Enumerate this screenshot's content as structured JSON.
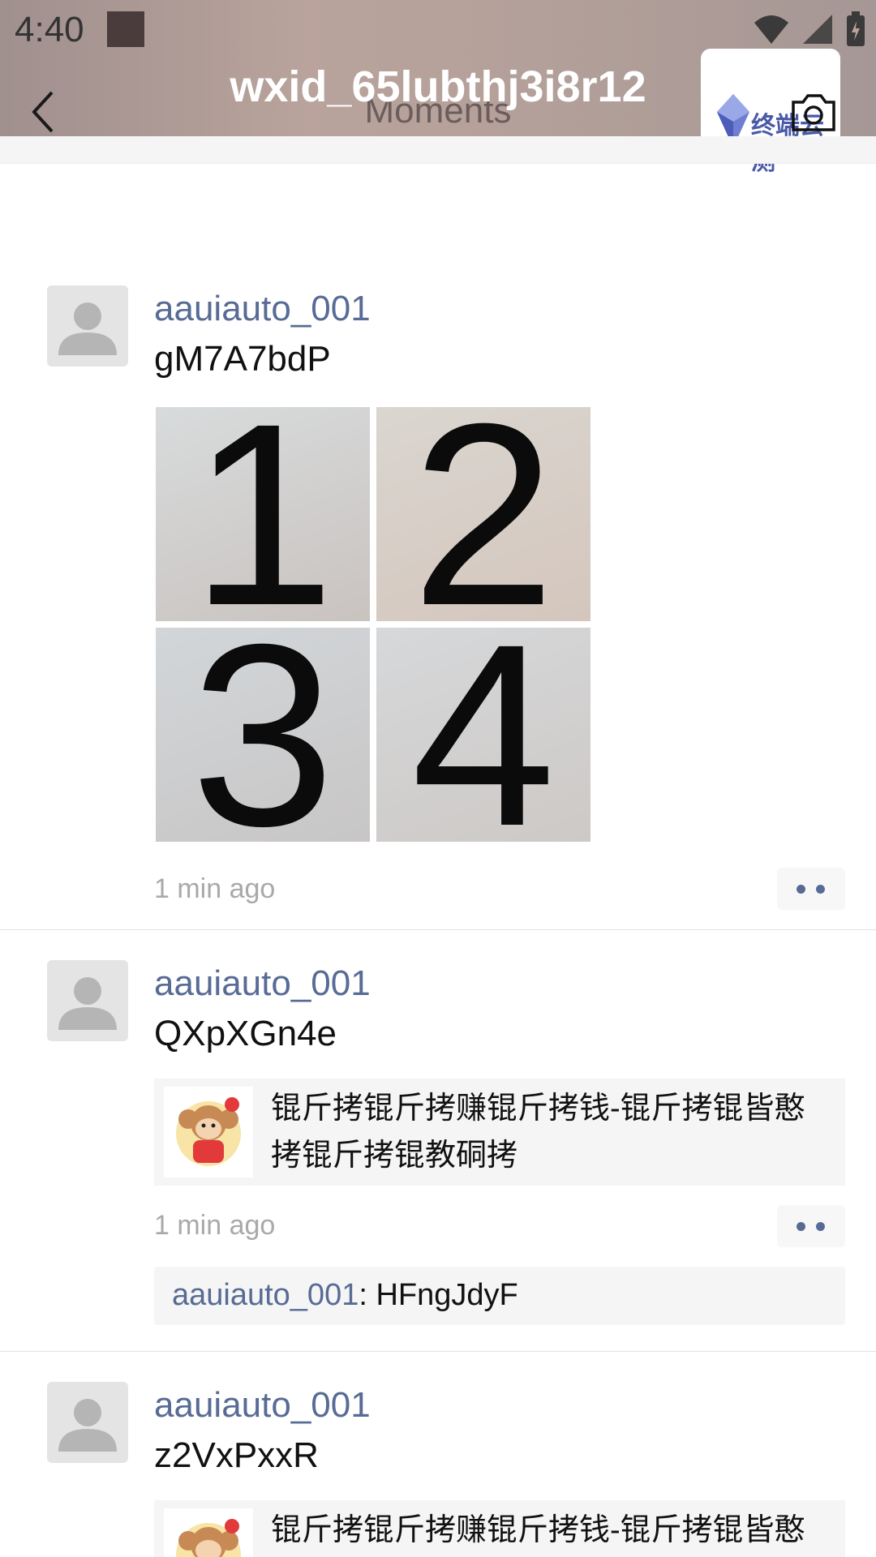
{
  "status_bar": {
    "time": "4:40"
  },
  "header": {
    "title": "wxid_65lubthj3i8r12",
    "subtitle": "Moments",
    "logo_text": "终端云测"
  },
  "posts": [
    {
      "author": "aauiauto_001",
      "text": "gM7A7bdP",
      "photos": [
        "1",
        "2",
        "3",
        "4"
      ],
      "time": "1 min ago"
    },
    {
      "author": "aauiauto_001",
      "text": "QXpXGn4e",
      "link_title": "锟斤拷锟斤拷赚锟斤拷钱-锟斤拷锟皆憨拷锟斤拷锟教硐拷",
      "time": "1 min ago",
      "comment": {
        "author": "aauiauto_001",
        "separator": ": ",
        "text": "HFngJdyF"
      }
    },
    {
      "author": "aauiauto_001",
      "text": "z2VxPxxR",
      "link_title": "锟斤拷锟斤拷赚锟斤拷钱-锟斤拷锟皆憨拷"
    }
  ],
  "icons": {
    "back": "chevron-left-icon",
    "camera": "camera-icon",
    "avatar": "default-avatar-icon",
    "more": "more-dots-icon",
    "wifi": "wifi-icon",
    "signal": "signal-icon",
    "battery": "battery-icon"
  },
  "colors": {
    "link_blue": "#576b95",
    "meta_gray": "#a9a9a9",
    "card_bg": "#f5f5f5"
  }
}
